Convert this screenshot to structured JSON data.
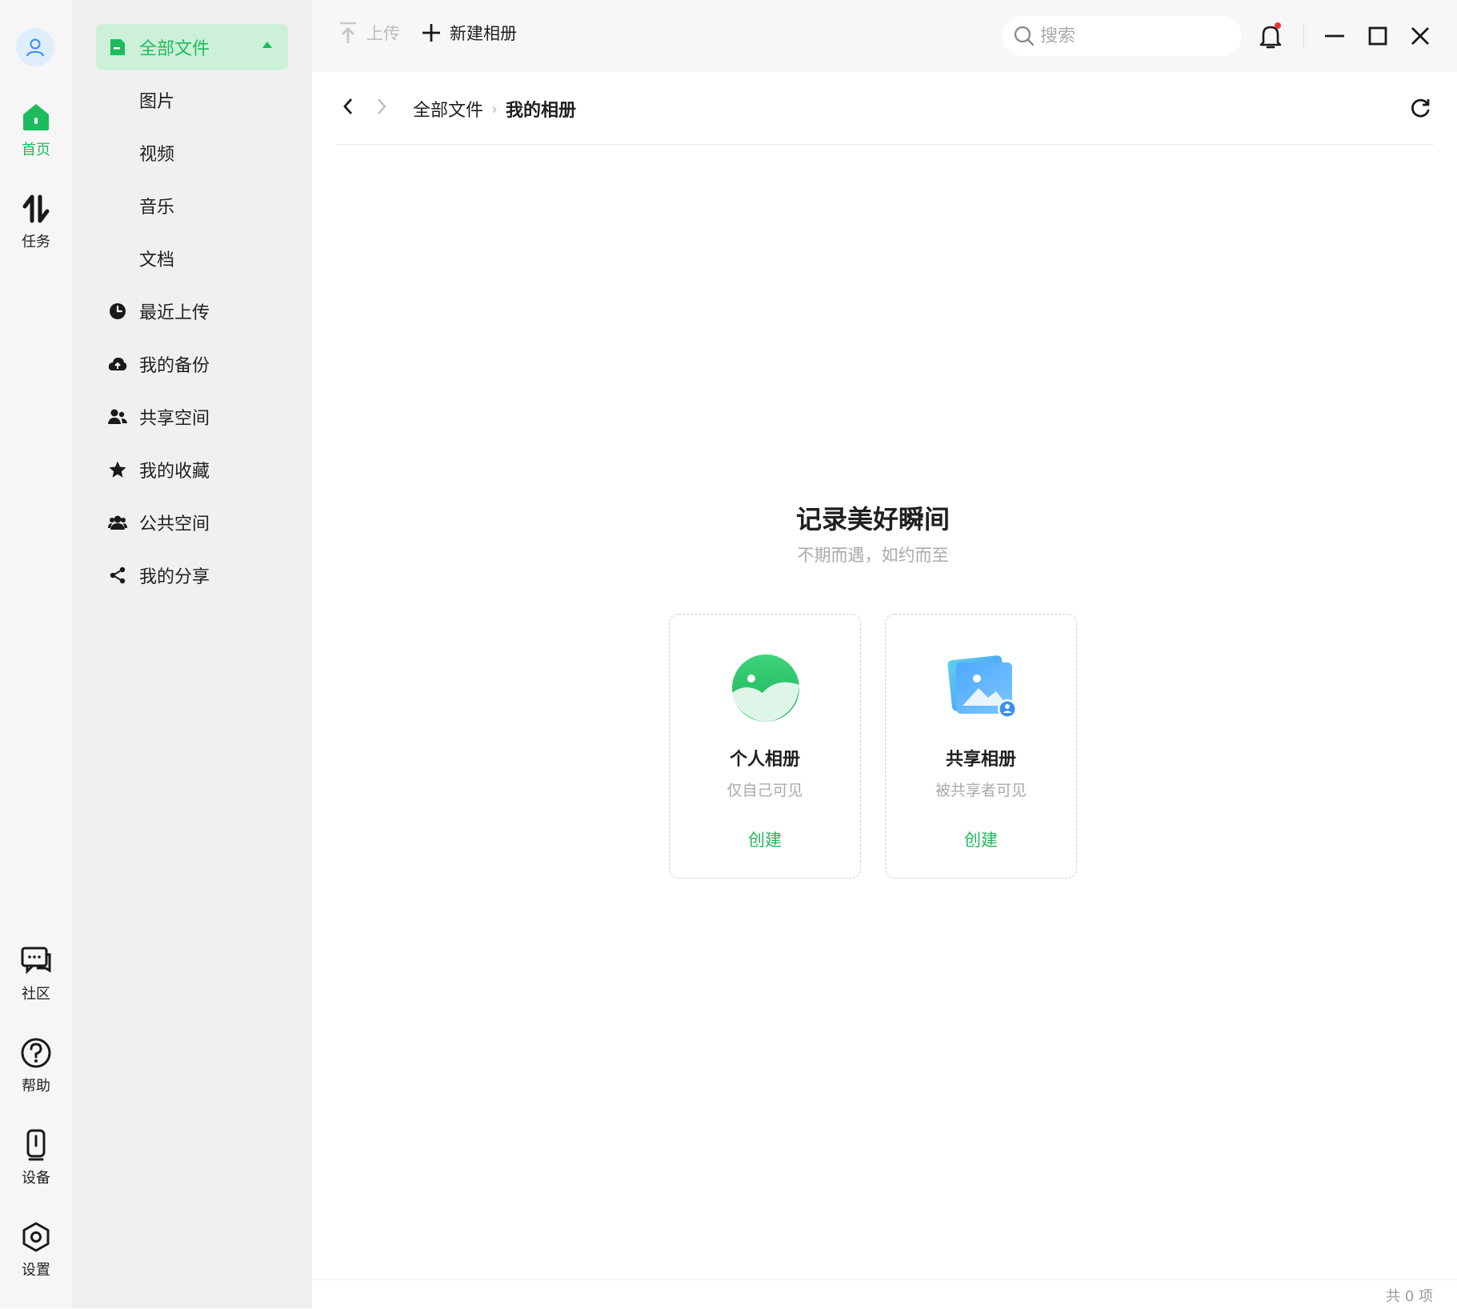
{
  "rail": {
    "items": [
      {
        "label": "首页",
        "icon": "home-icon"
      },
      {
        "label": "任务",
        "icon": "transfer-icon"
      },
      {
        "label": "社区",
        "icon": "chat-icon"
      },
      {
        "label": "帮助",
        "icon": "help-icon"
      },
      {
        "label": "设备",
        "icon": "device-icon"
      },
      {
        "label": "设置",
        "icon": "settings-icon"
      }
    ]
  },
  "sidebar": {
    "items": [
      {
        "label": "全部文件",
        "icon": "folder-icon"
      },
      {
        "label": "图片"
      },
      {
        "label": "视频"
      },
      {
        "label": "音乐"
      },
      {
        "label": "文档"
      },
      {
        "label": "最近上传",
        "icon": "clock-icon"
      },
      {
        "label": "我的备份",
        "icon": "cloud-upload-icon"
      },
      {
        "label": "共享空间",
        "icon": "people-icon"
      },
      {
        "label": "我的收藏",
        "icon": "star-icon"
      },
      {
        "label": "公共空间",
        "icon": "group-icon"
      },
      {
        "label": "我的分享",
        "icon": "share-icon"
      }
    ]
  },
  "toolbar": {
    "upload_label": "上传",
    "new_album_label": "新建相册",
    "search_placeholder": "搜索"
  },
  "breadcrumb": {
    "parent": "全部文件",
    "current": "我的相册"
  },
  "empty": {
    "title": "记录美好瞬间",
    "subtitle": "不期而遇，如约而至"
  },
  "cards": [
    {
      "title": "个人相册",
      "desc": "仅自己可见",
      "action": "创建"
    },
    {
      "title": "共享相册",
      "desc": "被共享者可见",
      "action": "创建"
    }
  ],
  "status": {
    "count": "共 0 项"
  },
  "colors": {
    "accent": "#1dbb5c",
    "active_bg": "#cdf0d9",
    "notification_dot": "#e53935"
  }
}
